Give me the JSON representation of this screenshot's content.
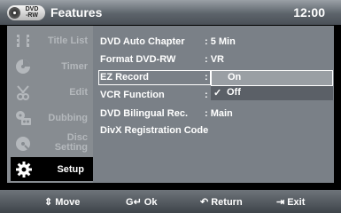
{
  "header": {
    "badge_top": "DVD",
    "badge_bottom": "-RW",
    "title": "Features",
    "clock": "12:00"
  },
  "sidebar": {
    "items": [
      {
        "label": "Title List",
        "icon": "title-list-icon"
      },
      {
        "label": "Timer",
        "icon": "timer-icon"
      },
      {
        "label": "Edit",
        "icon": "edit-icon"
      },
      {
        "label": "Dubbing",
        "icon": "dubbing-icon"
      },
      {
        "label_line1": "Disc",
        "label_line2": "Setting",
        "icon": "disc-icon"
      },
      {
        "label": "Setup",
        "icon": "gear-icon",
        "active": true
      }
    ]
  },
  "menu": {
    "rows": [
      {
        "label": "DVD Auto Chapter",
        "value": ": 5 Min"
      },
      {
        "label": "Format DVD-RW",
        "value": ": VR"
      },
      {
        "label": "EZ Record",
        "value": ":"
      },
      {
        "label": "VCR Function",
        "value": ":"
      },
      {
        "label": "DVD Bilingual Rec.",
        "value": ": Main"
      },
      {
        "label": "DivX Registration Code",
        "value": ""
      }
    ]
  },
  "popup": {
    "options": [
      "On",
      "Off"
    ],
    "highlighted": "On",
    "checked": "Off",
    "check_glyph": "✓"
  },
  "footer": {
    "move": {
      "glyph": "⇕",
      "label": "Move"
    },
    "ok": {
      "glyph": "↵",
      "label": "Ok",
      "prefix": "G"
    },
    "return": {
      "glyph": "↶",
      "label": "Return"
    },
    "exit": {
      "glyph": "⇥",
      "label": "Exit"
    }
  },
  "colors": {
    "panel": "#7a8087",
    "sidebar": "#878c91",
    "active_item": "#000000",
    "highlight": "#9a9fa4"
  }
}
